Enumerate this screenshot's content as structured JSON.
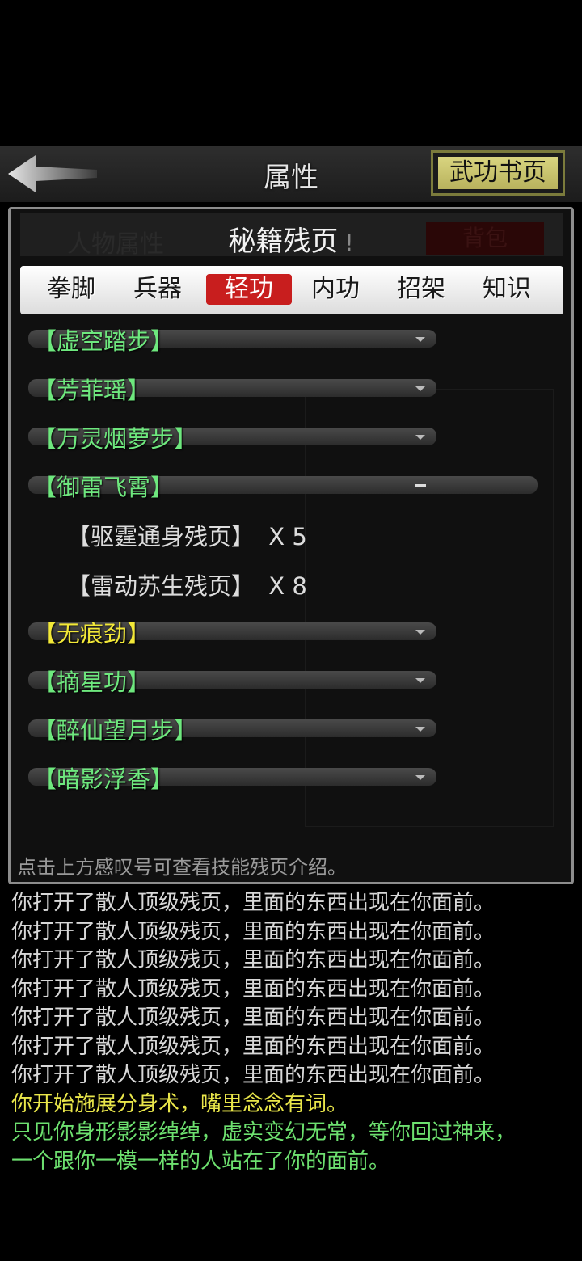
{
  "header": {
    "title": "属性",
    "book_button": "武功书页"
  },
  "panel": {
    "background_left_tab": "人物属性",
    "title": "秘籍残页",
    "info_mark": "!",
    "background_right_tab": "背包",
    "tabs": [
      "拳脚",
      "兵器",
      "轻功",
      "内功",
      "招架",
      "知识"
    ],
    "active_tab": "轻功",
    "categories": [
      {
        "label": "【虚空踏步】",
        "color": "green",
        "expanded": false
      },
      {
        "label": "【芳菲瑶】",
        "color": "green",
        "expanded": false
      },
      {
        "label": "【万灵烟萝步】",
        "color": "green",
        "expanded": false
      },
      {
        "label": "【御雷飞霄】",
        "color": "green",
        "expanded": true,
        "items": [
          {
            "name": "【驱霆通身残页】",
            "qty": "X 5"
          },
          {
            "name": "【雷动苏生残页】",
            "qty": "X 8"
          }
        ]
      },
      {
        "label": "【无痕劲】",
        "color": "yellow",
        "expanded": false
      },
      {
        "label": "【摘星功】",
        "color": "green",
        "expanded": false
      },
      {
        "label": "【醉仙望月步】",
        "color": "green",
        "expanded": false
      },
      {
        "label": "【暗影浮香】",
        "color": "green",
        "expanded": false
      }
    ],
    "hint": "点击上方感叹号可查看技能残页介绍。"
  },
  "log": [
    {
      "text": "你打开了散人顶级残页，里面的东西出现在你面前。",
      "color": "white"
    },
    {
      "text": "你打开了散人顶级残页，里面的东西出现在你面前。",
      "color": "white"
    },
    {
      "text": "你打开了散人顶级残页，里面的东西出现在你面前。",
      "color": "white"
    },
    {
      "text": "你打开了散人顶级残页，里面的东西出现在你面前。",
      "color": "white"
    },
    {
      "text": "你打开了散人顶级残页，里面的东西出现在你面前。",
      "color": "white"
    },
    {
      "text": "你打开了散人顶级残页，里面的东西出现在你面前。",
      "color": "white"
    },
    {
      "text": "你打开了散人顶级残页，里面的东西出现在你面前。",
      "color": "white"
    },
    {
      "text": "你开始施展分身术，嘴里念念有词。",
      "color": "yellow"
    },
    {
      "text": "只见你身形影影绰绰，虚实变幻无常，等你回过神来，",
      "color": "green"
    },
    {
      "text": "一个跟你一模一样的人站在了你的面前。",
      "color": "green"
    }
  ],
  "colors": {
    "green": "#6ee87e",
    "yellow": "#f2e838",
    "active_tab": "#c81e1e",
    "book_button": "#cfc970"
  }
}
